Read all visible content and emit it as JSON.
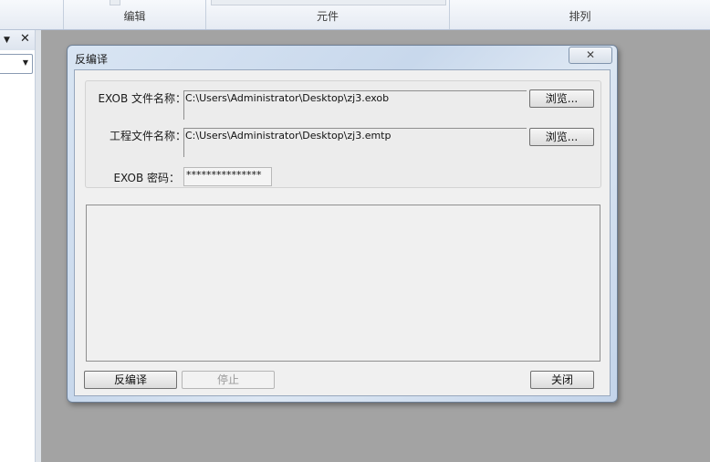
{
  "ribbon": {
    "groups": [
      {
        "label": "编辑"
      },
      {
        "label": "元件"
      },
      {
        "label": "排列"
      }
    ]
  },
  "dialog": {
    "title": "反编译",
    "exob_label": "EXOB 文件名称：",
    "exob_path": "C:\\Users\\Administrator\\Desktop\\zj3.exob",
    "project_label": "工程文件名称：",
    "project_path": "C:\\Users\\Administrator\\Desktop\\zj3.emtp",
    "password_label": "EXOB 密码：",
    "password_value": "***************",
    "browse_label": "浏览...",
    "decompile_label": "反编译",
    "stop_label": "停止",
    "close_label": "关闭",
    "close_glyph": "✕"
  }
}
